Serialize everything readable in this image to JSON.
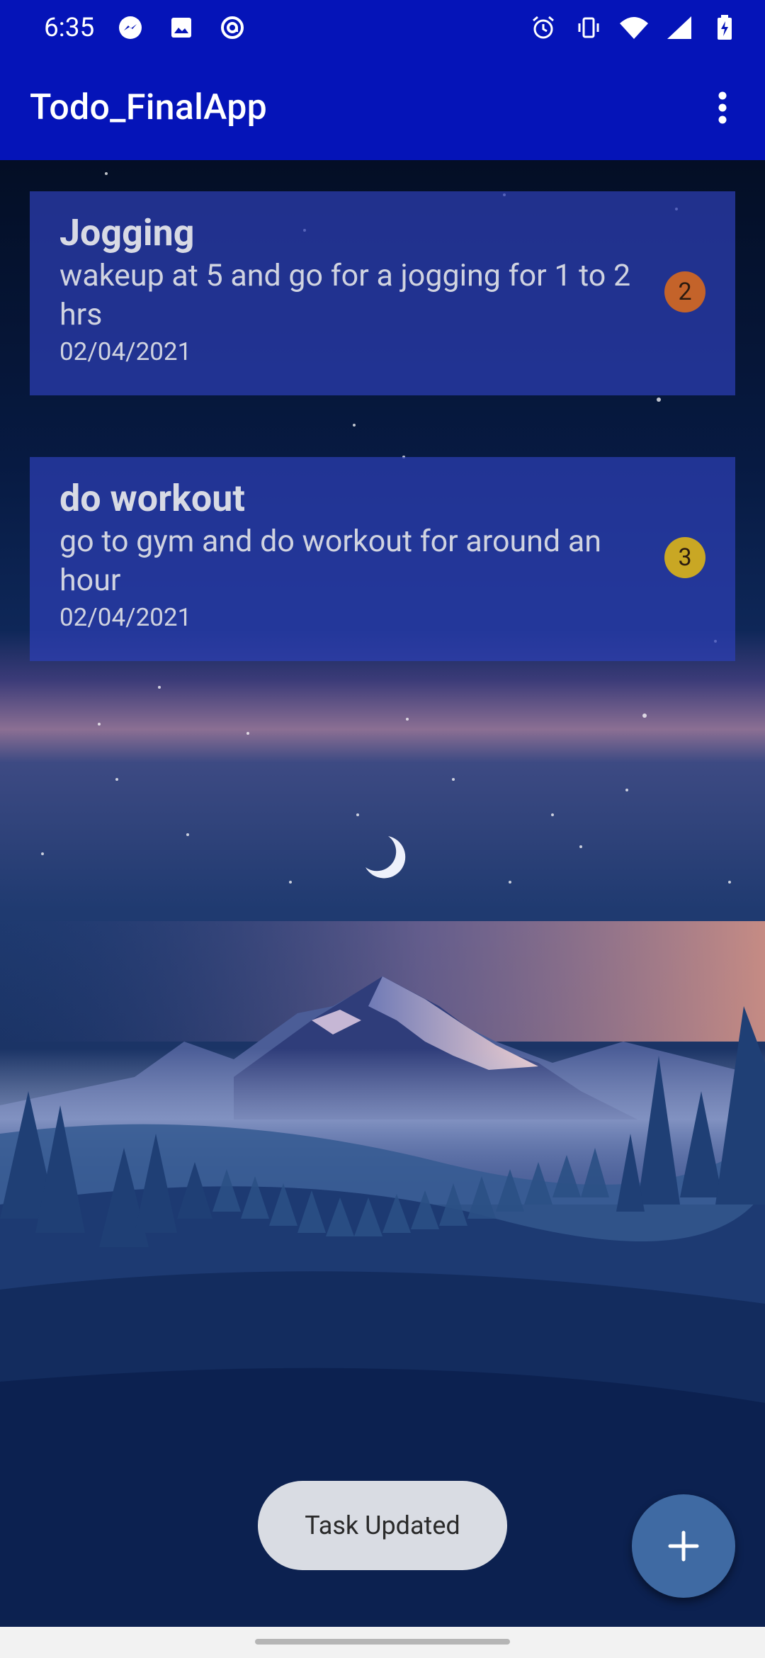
{
  "status_bar": {
    "time": "6:35",
    "left_icons": [
      "messenger-icon",
      "image-icon",
      "at-sign-icon"
    ],
    "right_icons": [
      "alarm-icon",
      "vibrate-icon",
      "wifi-icon",
      "signal-icon",
      "battery-charging-icon"
    ]
  },
  "app_bar": {
    "title": "Todo_FinalApp",
    "menu_icon": "more-vert-icon"
  },
  "tasks": [
    {
      "title": "Jogging",
      "description": "wakeup at 5 and go for a jogging for 1 to 2 hrs",
      "date": "02/04/2021",
      "priority": "2",
      "priority_color": "#c4632a"
    },
    {
      "title": "do workout",
      "description": "go to gym and do workout for around an hour",
      "date": "02/04/2021",
      "priority": "3",
      "priority_color": "#c9a724"
    }
  ],
  "toast": {
    "message": "Task Updated"
  },
  "fab": {
    "icon": "plus-icon"
  },
  "colors": {
    "app_bar": "#0514b8",
    "card": "#2c3fb4",
    "fab": "#3f6aa3"
  }
}
